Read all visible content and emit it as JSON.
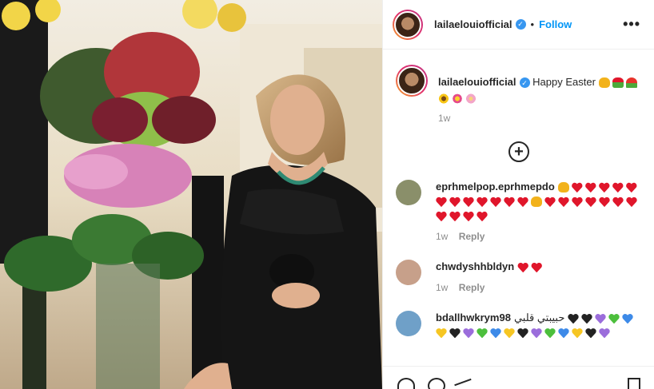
{
  "post": {
    "username": "lailaelouiofficial",
    "follow_label": "Follow",
    "separator": "•",
    "more_label": "•••"
  },
  "caption": {
    "username": "lailaelouiofficial",
    "text": "Happy Easter",
    "emoji_inline": [
      "raised-hands",
      "bouquet",
      "tulip"
    ],
    "emoji_line2": [
      "sunflower",
      "cherry-blossom",
      "blossom"
    ],
    "time": "1w"
  },
  "load_more": {
    "label": "+"
  },
  "comments": [
    {
      "username": "eprhmelpop.eprhmepdo",
      "emoji": [
        "raised-hands",
        "red-heart",
        "red-heart",
        "red-heart",
        "red-heart",
        "red-heart",
        "red-heart",
        "red-heart",
        "red-heart",
        "red-heart",
        "red-heart",
        "red-heart",
        "red-heart",
        "raised-hands",
        "red-heart",
        "red-heart",
        "red-heart",
        "red-heart",
        "red-heart",
        "red-heart",
        "red-heart",
        "red-heart",
        "red-heart",
        "red-heart",
        "red-heart"
      ],
      "time": "1w",
      "reply_label": "Reply",
      "avatar_color": "#8a8f6a"
    },
    {
      "username": "chwdyshhbldyn",
      "emoji": [
        "red-heart",
        "red-heart"
      ],
      "time": "1w",
      "reply_label": "Reply",
      "avatar_color": "#c7a08a"
    },
    {
      "username": "bdallhwkrym98",
      "text": "حبيبتي قلبي",
      "emoji": [
        "black-heart",
        "black-heart",
        "purple-heart",
        "green-heart",
        "blue-heart",
        "yellow-heart",
        "black-heart",
        "purple-heart",
        "green-heart",
        "blue-heart",
        "yellow-heart",
        "black-heart",
        "purple-heart",
        "green-heart",
        "blue-heart",
        "yellow-heart",
        "black-heart",
        "purple-heart"
      ],
      "time": "",
      "reply_label": "",
      "avatar_color": "#6fa0c8"
    }
  ],
  "colors": {
    "link_blue": "#0095f6",
    "verified_blue": "#3897f0",
    "muted": "#8e8e8e",
    "text": "#262626"
  }
}
